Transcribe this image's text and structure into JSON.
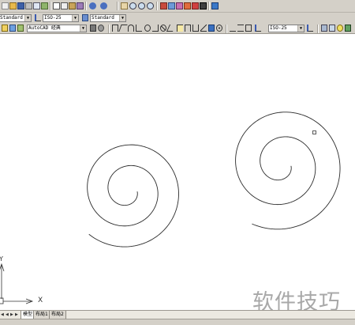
{
  "toolbar_top": {
    "icons": [
      "new-icon",
      "open-icon",
      "save-icon",
      "plot-icon",
      "preview-icon",
      "publish-icon",
      "cut-icon",
      "copy-icon",
      "paste-icon",
      "match-icon",
      "undo-icon",
      "redo-icon",
      "pan-icon",
      "zoom-realtime-icon",
      "zoom-window-icon",
      "zoom-previous-icon",
      "properties-icon",
      "design-center-icon",
      "tool-palettes-icon",
      "sheet-set-icon",
      "markup-icon",
      "calc-icon",
      "help-icon"
    ]
  },
  "styles_toolbar": {
    "text_style": "Standard",
    "dim_style": "ISO-25",
    "table_style": "Standard"
  },
  "workspace_toolbar": {
    "workspace": "AutoCAD 经典",
    "dim_style": "ISO-25"
  },
  "layout_tabs": {
    "model": "模型",
    "layout1": "布局1",
    "layout2": "布局2"
  },
  "canvas": {
    "axis_x_label": "X",
    "axis_y_label": "Y"
  },
  "watermark": "软件技巧"
}
